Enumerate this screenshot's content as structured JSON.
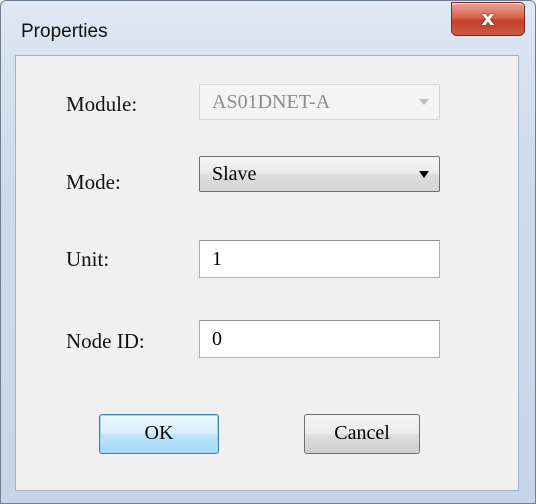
{
  "window": {
    "title": "Properties",
    "close_glyph": "x"
  },
  "form": {
    "module": {
      "label": "Module:",
      "value": "AS01DNET-A",
      "enabled": false
    },
    "mode": {
      "label": "Mode:",
      "value": "Slave",
      "enabled": true
    },
    "unit": {
      "label": "Unit:",
      "value": "1"
    },
    "node_id": {
      "label": "Node ID:",
      "value": "0"
    }
  },
  "buttons": {
    "ok": "OK",
    "cancel": "Cancel"
  },
  "colors": {
    "close_button": "#c9503b",
    "default_button_border": "#3c7fb1",
    "disabled_text": "#8d8d8d"
  },
  "icons": {
    "close": "close-icon",
    "dropdown": "chevron-down-icon"
  }
}
